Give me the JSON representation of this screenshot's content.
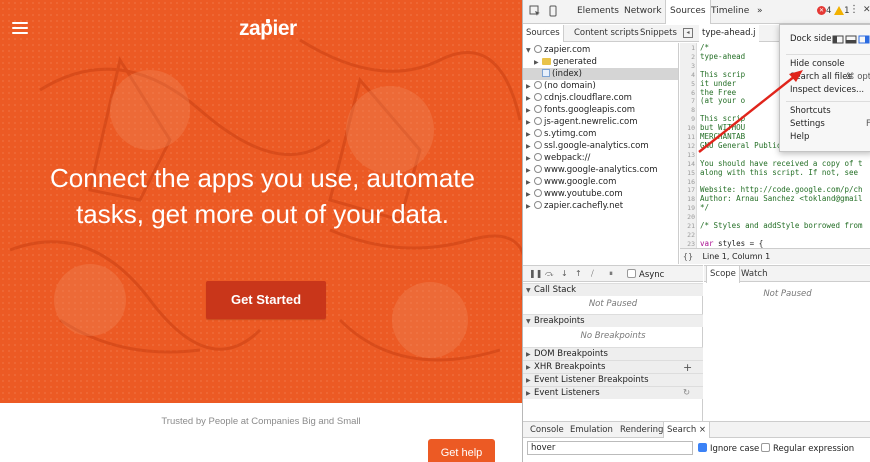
{
  "site": {
    "logo": "zapier",
    "headline_1": "Connect the apps you use, automate",
    "headline_2": "tasks, get more out of your data.",
    "cta": "Get Started",
    "trusted": "Trusted by People at Companies Big and Small",
    "help": "Get help"
  },
  "colors": {
    "accent": "#ec5a24",
    "cta": "#c9361a"
  },
  "devtools": {
    "tabs": [
      "Elements",
      "Network",
      "Sources",
      "Timeline",
      "»"
    ],
    "active_tab": "Sources",
    "errors": "4",
    "warnings": "1",
    "subtabs": [
      "Sources",
      "Content scripts",
      "Snippets"
    ],
    "open_file": "type-ahead.j",
    "tree": [
      "zapier.com",
      "generated",
      "(index)",
      "(no domain)",
      "cdnjs.cloudflare.com",
      "fonts.googleapis.com",
      "js-agent.newrelic.com",
      "s.ytimg.com",
      "ssl.google-analytics.com",
      "webpack://",
      "www.google-analytics.com",
      "www.google.com",
      "www.youtube.com",
      "zapier.cachefly.net"
    ],
    "code_lines": [
      "/*",
      " type-ahead",
      "",
      " This scrip",
      " it under",
      " the Free",
      " (at your o",
      "",
      " This scrip",
      " but WITHOU",
      " MERCHANTAB",
      " GNU General Public License for more",
      "",
      " You should have received a copy of t",
      " along with this script.  If not, see",
      "",
      " Website: http://code.google.com/p/ch",
      " Author: Arnau Sanchez <tokland@gmail",
      "*/",
      "",
      "/* Styles and addStyle borrowed from",
      "",
      "var styles = {"
    ],
    "status": "Line 1, Column 1",
    "debugger_async": "Async",
    "panes": {
      "call_stack": "Call Stack",
      "not_paused": "Not Paused",
      "breakpoints": "Breakpoints",
      "no_breakpoints": "No Breakpoints",
      "dom": "DOM Breakpoints",
      "xhr": "XHR Breakpoints",
      "event_listener_bp": "Event Listener Breakpoints",
      "event_listeners": "Event Listeners"
    },
    "scope_tabs": [
      "Scope",
      "Watch"
    ],
    "scope_msg": "Not Paused",
    "drawer_tabs": [
      "Console",
      "Emulation",
      "Rendering",
      "Search"
    ],
    "search_value": "hover",
    "ignore_case": "Ignore case",
    "regex": "Regular expression"
  },
  "menu": {
    "dock_side": "Dock side",
    "hide_console": "Hide console",
    "search_all_files": "Search all files",
    "search_shortcut": "⌘ opt",
    "inspect_devices": "Inspect devices...",
    "shortcuts": "Shortcuts",
    "settings": "Settings",
    "settings_sc": "F",
    "help": "Help"
  }
}
